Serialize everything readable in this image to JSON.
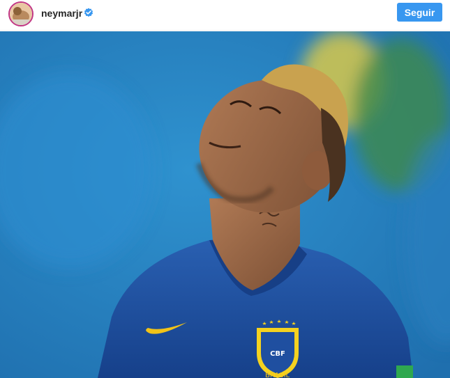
{
  "header": {
    "username": "neymarjr",
    "verified": true,
    "follow_label": "Seguir"
  },
  "photo": {
    "jersey_crest_text": "CBF",
    "jersey_front_text": "BRASIL"
  },
  "colors": {
    "follow_button": "#3897f0",
    "verified_badge": "#3897f0",
    "jersey_blue": "#1f4fa0",
    "crest_yellow": "#f4d21f",
    "background_blue": "#2a88c7"
  },
  "icons": [
    "verified-badge-icon",
    "nike-swoosh-icon",
    "star-icon"
  ]
}
